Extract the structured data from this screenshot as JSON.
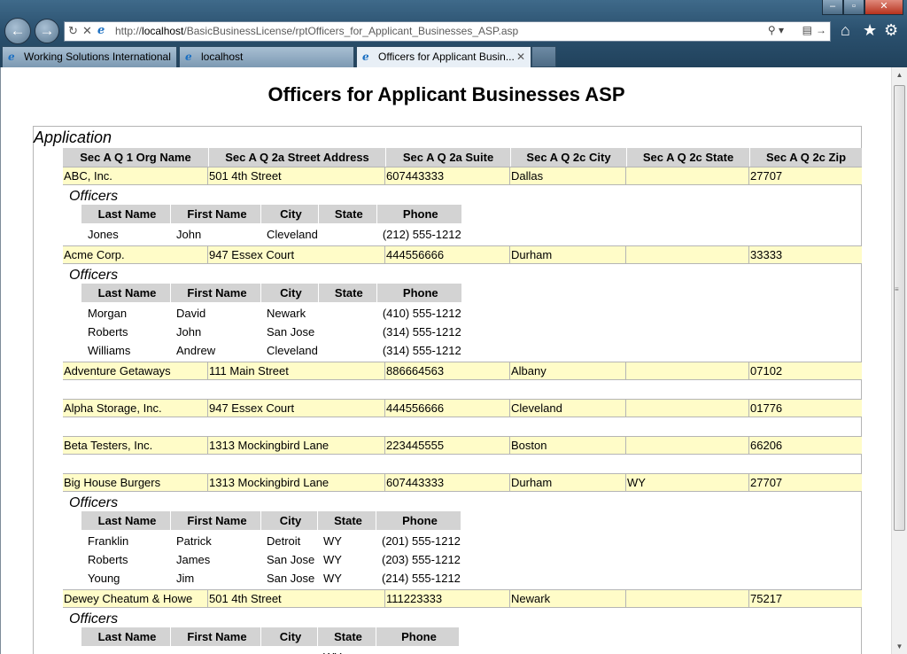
{
  "browser": {
    "url_prefix": "http://",
    "url_host": "localhost",
    "url_path": "/BasicBusinessLicense/rptOfficers_for_Applicant_Businesses_ASP.asp",
    "tabs": [
      {
        "label": "Working Solutions International"
      },
      {
        "label": "localhost"
      },
      {
        "label": "Officers for Applicant Busin..."
      }
    ],
    "icons": [
      "back-icon",
      "forward-icon",
      "refresh-icon",
      "stop-icon",
      "search-icon",
      "compat-icon",
      "go-icon",
      "home-icon",
      "favorites-icon",
      "tools-icon",
      "close-tab-icon"
    ]
  },
  "report": {
    "title": "Officers for Applicant Businesses ASP",
    "group_label": "Application",
    "columns": [
      "Sec A Q 1 Org Name",
      "Sec A Q 2a Street Address",
      "Sec A Q 2a Suite",
      "Sec A Q 2c City",
      "Sec A Q 2c State",
      "Sec A Q 2c Zip"
    ],
    "officers_label": "Officers",
    "officer_columns": [
      "Last Name",
      "First Name",
      "City",
      "State",
      "Phone"
    ],
    "businesses": [
      {
        "name": "ABC, Inc.",
        "street": "501 4th Street",
        "suite": "607443333",
        "city": "Dallas",
        "state": "",
        "zip": "27707",
        "officers": [
          {
            "last": "Jones",
            "first": "John",
            "city": "Cleveland",
            "state": "",
            "phone": "(212) 555-1212"
          }
        ]
      },
      {
        "name": "Acme Corp.",
        "street": "947 Essex Court",
        "suite": "444556666",
        "city": "Durham",
        "state": "",
        "zip": "33333",
        "officers": [
          {
            "last": "Morgan",
            "first": "David",
            "city": "Newark",
            "state": "",
            "phone": "(410) 555-1212"
          },
          {
            "last": "Roberts",
            "first": "John",
            "city": "San Jose",
            "state": "",
            "phone": "(314) 555-1212"
          },
          {
            "last": "Williams",
            "first": "Andrew",
            "city": "Cleveland",
            "state": "",
            "phone": "(314) 555-1212"
          }
        ]
      },
      {
        "name": "Adventure Getaways",
        "street": "111 Main Street",
        "suite": "886664563",
        "city": "Albany",
        "state": "",
        "zip": "07102",
        "officers": []
      },
      {
        "name": "Alpha Storage, Inc.",
        "street": "947 Essex Court",
        "suite": "444556666",
        "city": "Cleveland",
        "state": "",
        "zip": "01776",
        "officers": []
      },
      {
        "name": "Beta Testers, Inc.",
        "street": "1313 Mockingbird Lane",
        "suite": "223445555",
        "city": "Boston",
        "state": "",
        "zip": "66206",
        "officers": []
      },
      {
        "name": "Big House Burgers",
        "street": "1313 Mockingbird Lane",
        "suite": "607443333",
        "city": "Durham",
        "state": "WY",
        "zip": "27707",
        "officers": [
          {
            "last": "Franklin",
            "first": "Patrick",
            "city": "Detroit",
            "state": "WY",
            "phone": "(201) 555-1212"
          },
          {
            "last": "Roberts",
            "first": "James",
            "city": "San Jose",
            "state": "WY",
            "phone": "(203) 555-1212"
          },
          {
            "last": "Young",
            "first": "Jim",
            "city": "San Jose",
            "state": "WY",
            "phone": "(214) 555-1212"
          }
        ]
      },
      {
        "name": "Dewey Cheatum & Howe",
        "street": "501 4th Street",
        "suite": "111223333",
        "city": "Newark",
        "state": "",
        "zip": "75217",
        "officers": [
          {
            "last": "",
            "first": "",
            "city": "",
            "state": "WY",
            "phone": ""
          }
        ]
      }
    ]
  }
}
